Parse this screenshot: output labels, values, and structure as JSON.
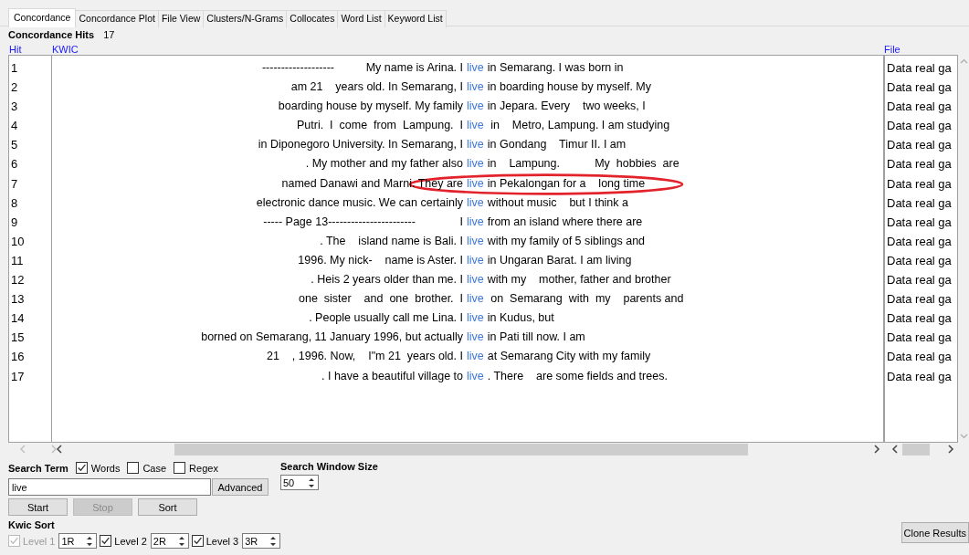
{
  "tabs": [
    {
      "label": "Concordance",
      "selected": true
    },
    {
      "label": "Concordance Plot",
      "selected": false
    },
    {
      "label": "File View",
      "selected": false
    },
    {
      "label": "Clusters/N-Grams",
      "selected": false
    },
    {
      "label": "Collocates",
      "selected": false
    },
    {
      "label": "Word List",
      "selected": false
    },
    {
      "label": "Keyword List",
      "selected": false
    }
  ],
  "hits_label": "Concordance Hits",
  "hits_count": "17",
  "columns": {
    "hit": "Hit",
    "kwic": "KWIC",
    "file": "File"
  },
  "rows": [
    {
      "hit": "1",
      "left": "-------------------          My name is Arina. I",
      "word": "live",
      "right": "in Semarang. I was born in",
      "file": "Data real ga",
      "circled": false
    },
    {
      "hit": "2",
      "left": "am 21    years old. In Semarang, I",
      "word": "live",
      "right": "in boarding house by myself. My",
      "file": "Data real ga",
      "circled": false
    },
    {
      "hit": "3",
      "left": "boarding house by myself. My family",
      "word": "live",
      "right": "in Jepara. Every    two weeks, I",
      "file": "Data real ga",
      "circled": false
    },
    {
      "hit": "4",
      "left": "Putri.  I  come  from  Lampung.  I",
      "word": "live",
      "right": " in    Metro, Lampung. I am studying",
      "file": "Data real ga",
      "circled": false
    },
    {
      "hit": "5",
      "left": "in Diponegoro University. In Semarang, I",
      "word": "live",
      "right": "in Gondang    Timur II. I am",
      "file": "Data real ga",
      "circled": false
    },
    {
      "hit": "6",
      "left": ". My mother and my father also",
      "word": "live",
      "right": "in    Lampung.           My  hobbies  are",
      "file": "Data real ga",
      "circled": false
    },
    {
      "hit": "7",
      "left": "named Danawi and Marni. They are",
      "word": "live",
      "right": "in Pekalongan for a    long time",
      "file": "Data real ga",
      "circled": true
    },
    {
      "hit": "8",
      "left": "electronic dance music. We can certainly",
      "word": "live",
      "right": "without music    but I think a",
      "file": "Data real ga",
      "circled": false
    },
    {
      "hit": "9",
      "left": "----- Page 13-----------------------              I",
      "word": "live",
      "right": "from an island where there are",
      "file": "Data real ga",
      "circled": false
    },
    {
      "hit": "10",
      "left": ". The    island name is Bali. I",
      "word": "live",
      "right": "with my family of 5 siblings and",
      "file": "Data real ga",
      "circled": false
    },
    {
      "hit": "11",
      "left": "1996. My nick-    name is Aster. I",
      "word": "live",
      "right": "in Ungaran Barat. I am living",
      "file": "Data real ga",
      "circled": false
    },
    {
      "hit": "12",
      "left": ". Heis 2 years older than me. I",
      "word": "live",
      "right": "with my    mother, father and brother",
      "file": "Data real ga",
      "circled": false
    },
    {
      "hit": "13",
      "left": "one  sister    and  one  brother.  I",
      "word": "live",
      "right": " on  Semarang  with  my    parents and",
      "file": "Data real ga",
      "circled": false
    },
    {
      "hit": "14",
      "left": ". People usually call me Lina. I",
      "word": "live",
      "right": "in Kudus, but",
      "file": "Data real ga",
      "circled": false
    },
    {
      "hit": "15",
      "left": "borned on Semarang, 11 January 1996, but actually",
      "word": "live",
      "right": "in Pati till now. I am",
      "file": "Data real ga",
      "circled": false
    },
    {
      "hit": "16",
      "left": "21    , 1996. Now,    I\"m 21  years old. I",
      "word": "live",
      "right": "at Semarang City with my family",
      "file": "Data real ga",
      "circled": false
    },
    {
      "hit": "17",
      "left": ". I have a beautiful village to",
      "word": "live",
      "right": ". There    are some fields and trees.",
      "file": "Data real ga",
      "circled": false
    }
  ],
  "search": {
    "label": "Search Term",
    "value": "live",
    "options": [
      {
        "label": "Words",
        "checked": true
      },
      {
        "label": "Case",
        "checked": false
      },
      {
        "label": "Regex",
        "checked": false
      }
    ],
    "advanced": "Advanced"
  },
  "window_size": {
    "label": "Search Window Size",
    "value": "50"
  },
  "buttons": [
    {
      "label": "Start",
      "disabled": false
    },
    {
      "label": "Stop",
      "disabled": true
    },
    {
      "label": "Sort",
      "disabled": false
    }
  ],
  "kwic_sort": {
    "label": "Kwic Sort",
    "levels": [
      {
        "label": "Level 1",
        "checked": true,
        "disabled": true,
        "value": "1R"
      },
      {
        "label": "Level 2",
        "checked": true,
        "disabled": false,
        "value": "2R"
      },
      {
        "label": "Level 3",
        "checked": true,
        "disabled": false,
        "value": "3R"
      }
    ]
  },
  "clone": "Clone Results"
}
